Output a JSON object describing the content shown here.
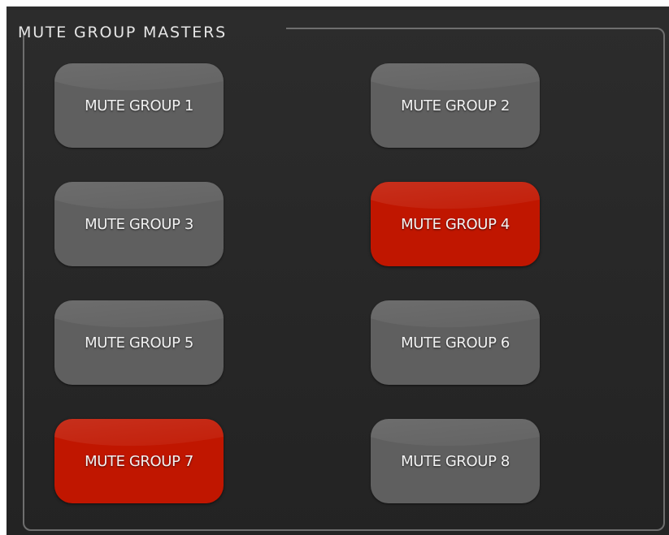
{
  "panel": {
    "title": "MUTE GROUP MASTERS"
  },
  "colors": {
    "background": "#2a2a2a",
    "button_off": "#5f5f5f",
    "button_on": "#c01600",
    "frame": "#6e6e6e",
    "text": "#f2f2f2"
  },
  "mute_groups": [
    {
      "label": "MUTE GROUP 1",
      "active": false
    },
    {
      "label": "MUTE GROUP 2",
      "active": false
    },
    {
      "label": "MUTE GROUP 3",
      "active": false
    },
    {
      "label": "MUTE GROUP 4",
      "active": true
    },
    {
      "label": "MUTE GROUP 5",
      "active": false
    },
    {
      "label": "MUTE GROUP 6",
      "active": false
    },
    {
      "label": "MUTE GROUP 7",
      "active": true
    },
    {
      "label": "MUTE GROUP 8",
      "active": false
    }
  ]
}
